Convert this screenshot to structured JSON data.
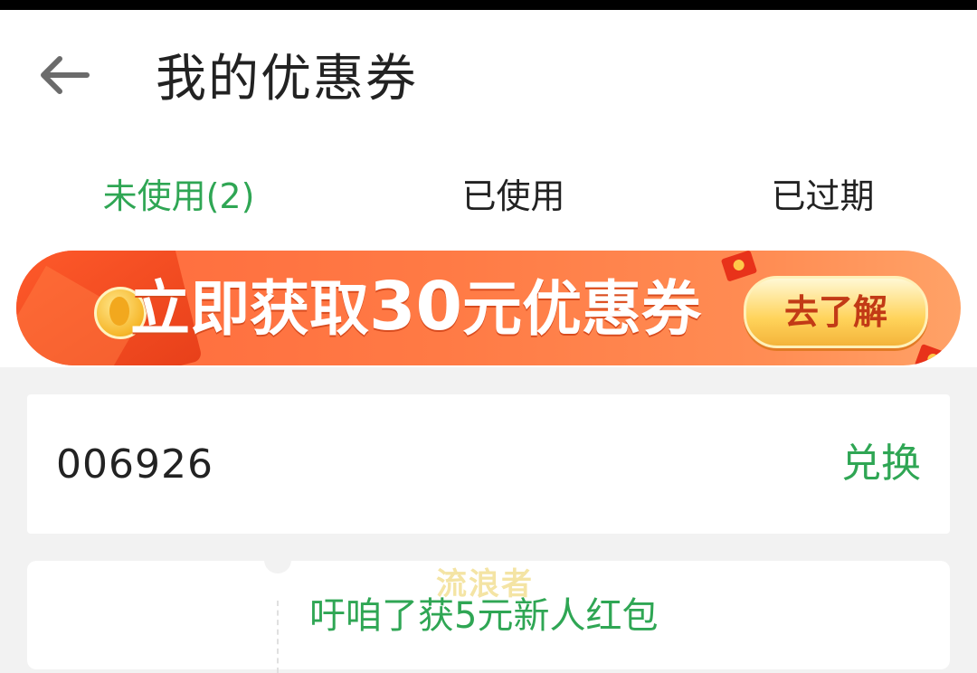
{
  "header": {
    "title": "我的优惠券",
    "back_icon": "back-arrow-icon"
  },
  "tabs": [
    {
      "label": "未使用(2)",
      "active": true
    },
    {
      "label": "已使用",
      "active": false
    },
    {
      "label": "已过期",
      "active": false
    }
  ],
  "banner": {
    "text_prefix": "立即获取",
    "text_number": "30",
    "text_suffix": "元优惠券",
    "button_label": "去了解"
  },
  "redeem": {
    "code_value": "006926",
    "button_label": "兑换"
  },
  "coupon": {
    "title": "吁咱了获5元新人红包"
  },
  "watermark": "流浪者",
  "colors": {
    "accent": "#2fa654",
    "banner_start": "#ff6a3c",
    "banner_end": "#ffa267",
    "page_bg": "#f2f2f2"
  }
}
